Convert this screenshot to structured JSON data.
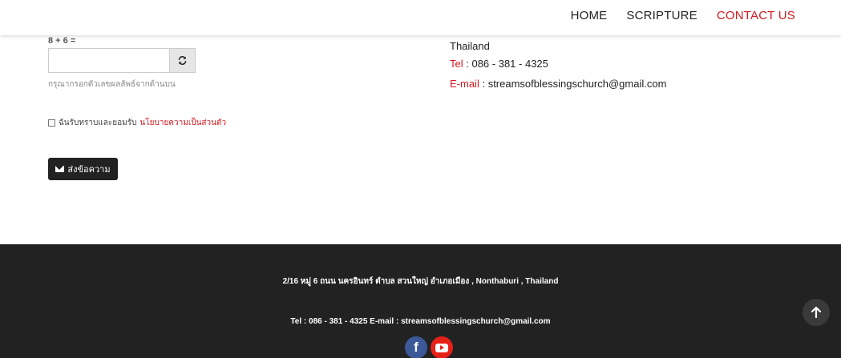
{
  "nav": {
    "items": [
      {
        "label": "HOME"
      },
      {
        "label": "SCRIPTURE"
      },
      {
        "label": "CONTACT US"
      }
    ]
  },
  "form": {
    "captcha_question": "8 + 6 =",
    "captcha_value": "",
    "captcha_hint": "กรุณากรอกตัวเลขผลลัพธ์จากด้านบน",
    "consent_text": "ฉันรับทราบและยอมรับ",
    "consent_link": "นโยบายความเป็นส่วนตัว",
    "send_label": "ส่งข้อความ"
  },
  "contact": {
    "country": "Thailand",
    "tel_label": "Tel",
    "tel_value": ": 086 - 381 - 4325",
    "email_label": "E-mail",
    "email_value": ":  streamsofblessingschurch@gmail.com"
  },
  "footer": {
    "address": "2/16 หมู่ 6 ถนน นครอินทร์ ตำบล สวนใหญ่ อำเภอเมือง , Nonthaburi , Thailand",
    "contact_line": "Tel : 086 - 381 - 4325   E-mail : streamsofblessingschurch@gmail.com",
    "social": [
      "facebook-icon",
      "youtube-icon"
    ]
  },
  "colors": {
    "accent": "#d71920",
    "footer_bg": "#222222"
  }
}
